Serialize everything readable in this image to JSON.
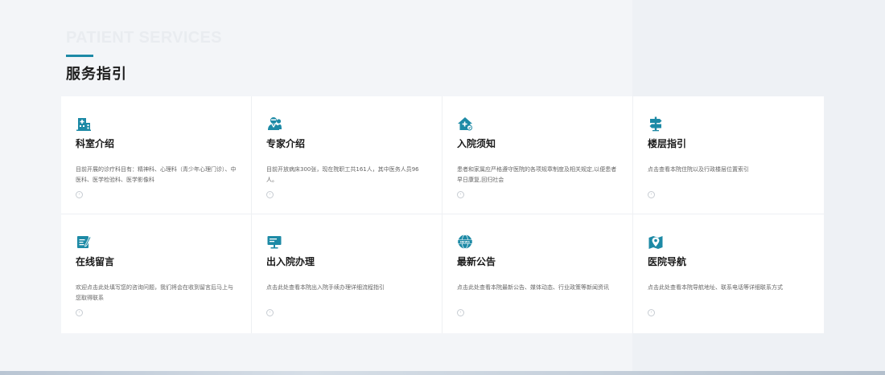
{
  "section": {
    "eyebrow": "PATIENT SERVICES",
    "title": "服务指引"
  },
  "colors": {
    "accent": "#1d8aa6",
    "card_bg": "#ffffff",
    "page_bg": "#f3f5f8"
  },
  "cards": [
    {
      "icon": "hospital-building-icon",
      "title": "科室介绍",
      "desc": "目前开展的诊疗科目有：精神科、心理科（青少年心理门诊）、中医科、医学检验科、医学影像科",
      "more_icon": "chevron-right-icon"
    },
    {
      "icon": "doctor-team-icon",
      "title": "专家介绍",
      "desc": "目前开放病床300张，现在院职工共161人，其中医务人员96人。",
      "more_icon": "chevron-right-icon"
    },
    {
      "icon": "home-admission-icon",
      "title": "入院须知",
      "desc": "患者和家属应严格遵守医院的各项规章制度及相关规定,以便患者早日康复,回归社会",
      "more_icon": "chevron-right-icon"
    },
    {
      "icon": "signpost-icon",
      "title": "楼层指引",
      "desc": "点击查看本院住院以及行政楼层位置索引",
      "more_icon": "chevron-right-icon"
    },
    {
      "icon": "edit-message-icon",
      "title": "在线留言",
      "desc": "欢迎点击此处填写您的咨询问题，我们将会在收到留言后马上与您取得联系",
      "more_icon": "chevron-right-icon"
    },
    {
      "icon": "monitor-procedure-icon",
      "title": "出入院办理",
      "desc": "点击此处查看本院出入院手续办理详细流程指引",
      "more_icon": "chevron-right-icon"
    },
    {
      "icon": "news-globe-icon",
      "title": "最新公告",
      "desc": "点击此处查看本院最新公告、媒体动态、行业政策等新闻资讯",
      "more_icon": "chevron-right-icon"
    },
    {
      "icon": "map-location-icon",
      "title": "医院导航",
      "desc": "点击此处查看本院导航地址、联系电话等详细联系方式",
      "more_icon": "chevron-right-icon"
    }
  ]
}
